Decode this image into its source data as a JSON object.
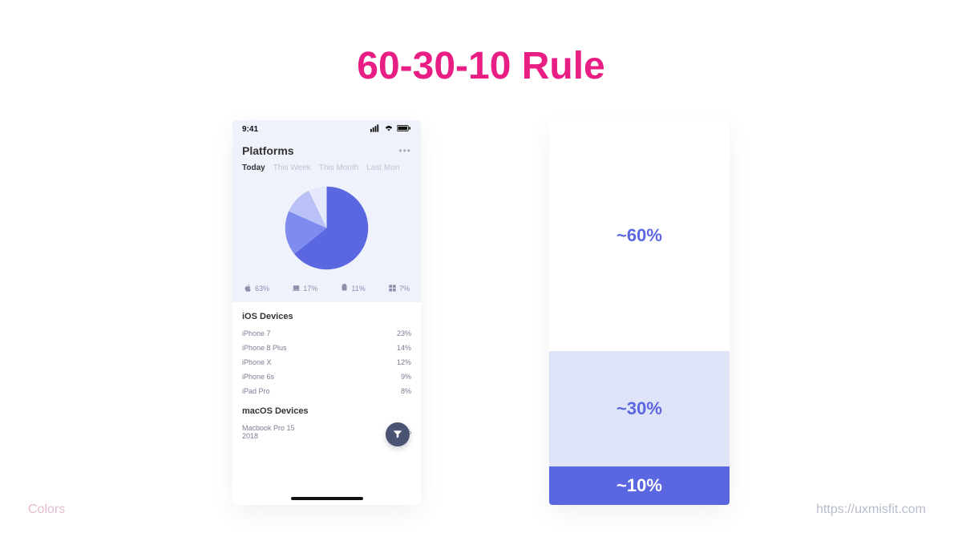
{
  "title": "60-30-10 Rule",
  "footer": {
    "left": "Colors",
    "right": "https://uxmisfit.com"
  },
  "colors": {
    "accent": "#5a67e0",
    "pink": "#e91e84",
    "light": "#dfe3f7",
    "panel": "#f0f2fb"
  },
  "stack": {
    "rows": [
      {
        "label": "~60%",
        "value": 60,
        "bg": "#ffffff",
        "fg": "#5a67e0"
      },
      {
        "label": "~30%",
        "value": 30,
        "bg": "#dfe3f7",
        "fg": "#5a67e0"
      },
      {
        "label": "~10%",
        "value": 10,
        "bg": "#5a67e0",
        "fg": "#ffffff"
      }
    ]
  },
  "phone": {
    "status": {
      "time": "9:41",
      "signal_icon": "signal",
      "wifi_icon": "wifi",
      "battery_icon": "battery"
    },
    "top": {
      "title": "Platforms",
      "tabs": [
        "Today",
        "This Week",
        "This Month",
        "Last Mon"
      ],
      "active_tab_index": 0,
      "platform_breakdown": [
        {
          "icon": "apple",
          "pct": "63%"
        },
        {
          "icon": "macos",
          "pct": "17%"
        },
        {
          "icon": "android",
          "pct": "11%"
        },
        {
          "icon": "windows",
          "pct": "7%"
        }
      ]
    },
    "lists": [
      {
        "title": "iOS Devices",
        "rows": [
          {
            "name": "iPhone 7",
            "pct": 23
          },
          {
            "name": "iPhone 8 Plus",
            "pct": 14
          },
          {
            "name": "iPhone X",
            "pct": 12
          },
          {
            "name": "iPhone 6s",
            "pct": 9
          },
          {
            "name": "iPad Pro",
            "pct": 8
          }
        ]
      },
      {
        "title": "macOS Devices",
        "rows": [
          {
            "name": "Macbook Pro 15 2018",
            "pct": 17
          }
        ]
      }
    ],
    "fab_icon": "funnel"
  },
  "chart_data": {
    "type": "pie",
    "title": "Platforms",
    "series": [
      {
        "name": "Apple",
        "value": 63,
        "color": "#5a67e0"
      },
      {
        "name": "macOS",
        "value": 17,
        "color": "#7e8cf0"
      },
      {
        "name": "Android",
        "value": 11,
        "color": "#b9c1f6"
      },
      {
        "name": "Windows",
        "value": 7,
        "color": "#e6e9fb"
      }
    ]
  }
}
